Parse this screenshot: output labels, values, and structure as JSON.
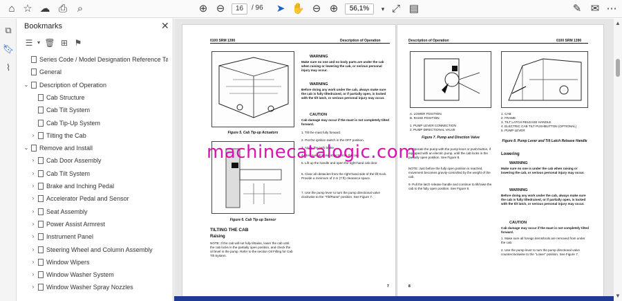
{
  "toolbar": {
    "current_page": "16",
    "total_pages": "/ 96",
    "zoom": "56,1%",
    "icons": [
      "home-icon",
      "star-icon",
      "upload-icon",
      "print-icon",
      "zoom-search-icon",
      "page-up-icon",
      "page-down-icon",
      "cursor-icon",
      "hand-icon",
      "zoom-out-icon",
      "zoom-in-icon",
      "fit-page-icon",
      "read-mode-icon",
      "sign-icon",
      "comment-icon",
      "more-icon"
    ]
  },
  "bookmarks": {
    "title": "Bookmarks",
    "items": [
      {
        "label": "Series Code / Model Designation Reference Table",
        "level": 0,
        "expander": ""
      },
      {
        "label": "General",
        "level": 0,
        "expander": ""
      },
      {
        "label": "Description of Operation",
        "level": 0,
        "expander": "open"
      },
      {
        "label": "Cab Structure",
        "level": 1,
        "expander": ""
      },
      {
        "label": "Cab Tilt System",
        "level": 1,
        "expander": ""
      },
      {
        "label": "Cab Tip-Up System",
        "level": 1,
        "expander": ""
      },
      {
        "label": "Tilting the Cab",
        "level": 1,
        "expander": "closed"
      },
      {
        "label": "Remove and Install",
        "level": 0,
        "expander": "open"
      },
      {
        "label": "Cab Door Assembly",
        "level": 1,
        "expander": "closed"
      },
      {
        "label": "Cab Tilt System",
        "level": 1,
        "expander": "closed"
      },
      {
        "label": "Brake and Inching Pedal",
        "level": 1,
        "expander": "closed"
      },
      {
        "label": "Accelerator Pedal and Sensor",
        "level": 1,
        "expander": "closed"
      },
      {
        "label": "Seat Assembly",
        "level": 1,
        "expander": "closed"
      },
      {
        "label": "Power Assist Armrest",
        "level": 1,
        "expander": "closed"
      },
      {
        "label": "Instrument Panel",
        "level": 1,
        "expander": "closed"
      },
      {
        "label": "Steering Wheel and Column Assembly",
        "level": 1,
        "expander": "closed"
      },
      {
        "label": "Window Wipers",
        "level": 1,
        "expander": "closed"
      },
      {
        "label": "Window Washer System",
        "level": 1,
        "expander": "closed"
      },
      {
        "label": "Window Washer Spray Nozzles",
        "level": 1,
        "expander": "closed"
      }
    ]
  },
  "left_page": {
    "header_left": "0100 SRM 1390",
    "header_right": "Description of Operation",
    "fig5_caption": "Figure 5. Cab Tip-up Actuators",
    "fig6_caption": "Figure 6. Cab Tip-up Sensor",
    "section_title": "TILTING THE CAB",
    "subsection": "Raising",
    "note": "NOTE: If the cab will not fully tiltraise, lower the cab until the cab locks in the partially open position, and check the oil level in the pump. Refer to the section Oil Filling for Cab Tilt System.",
    "warning1_title": "WARNING",
    "warning1_text": "Make sure no one and no body parts are under the cab when raising or lowering the cab, or serious personal injury may occur.",
    "warning2_title": "WARNING",
    "warning2_text": "Before doing any work under the cab, always make sure the cab is fully tiltedraised, or if partially open, is locked with the tilt latch, or serious personal injury may occur.",
    "caution_title": "CAUTION",
    "caution_text": "Cab damage may occur if the mast is not completely tilted forward.",
    "step1": "1.   Tilt the mast fully forward.",
    "step2": "2.   Put the ignition switch in the OFF position.",
    "step3": "3.   Apply the park brake.",
    "step4": "4.   Remove all loose objects from the cab.",
    "step5": "5.   Lift up the handle and open the right-hand cab door.",
    "step6": "6.   Clear all obstacles from the right-hand side of the lift truck. Provide a minimum of 2 m (7 ft) clearance space.",
    "step7": "7.   Use the pump lever to turn the pump directional valve clockwise to the \"Tilt/Raise\" position. See Figure 7.",
    "page_number": "7"
  },
  "right_page": {
    "header_left": "Description of Operation",
    "header_right": "0100 SRM 1390",
    "fig7_legend": [
      "A.   LOWER POSITION",
      "B.   RAISE POSITION",
      "",
      "1.   PUMP LEVER CONNECTION",
      "2.   PUMP DIRECTIONAL VALVE"
    ],
    "fig7_caption": "Figure 7. Pump and Direction Valve",
    "fig8_legend": [
      "1.   CAB",
      "2.   FRAME",
      "3.   TILT LATCH RELEASE HANDLE",
      "4.   ELECTRIC CAB TILT PUSHBUTTON (OPTIONAL)",
      "5.   PUMP LEVER"
    ],
    "fig8_caption": "Figure 8. Pump Lever and Tilt Latch Release Handle",
    "step8": "8.   Operate the pump with the pump lever or push-button, if equipped with an electric pump, until the cab locks in the partially open position. See Figure 8.",
    "note2": "NOTE: Just before the fully open position is reached, movement becomes gravity-controlled by the weight of the cab.",
    "step9": "9.   Pull the latch release handle and continue to tilt/raise the cab to the fully open position. See Figure 8.",
    "lowering_title": "Lowering",
    "w1_title": "WARNING",
    "w1_text": "Make sure no one is under the cab when raising or lowering the cab, or serious personal injury may occur.",
    "w2_title": "WARNING",
    "w2_text": "Before doing any work under the cab, always make sure the cab is fully tiltedraised, or if partially open, is locked with the tilt latch, or serious personal injury may occur.",
    "caution_title": "CAUTION",
    "caution_text": "Cab damage may occur if the mast is not completely tilted forward.",
    "lstep1": "1.   Make sure all foreign items/tools are removed from under the cab.",
    "lstep2": "2.   Use the pump lever to turn the pump directional valve counterclockwise to the \"Lower\" position. See Figure 7.",
    "page_number": "8"
  },
  "watermark": "machinecatalogic.com"
}
